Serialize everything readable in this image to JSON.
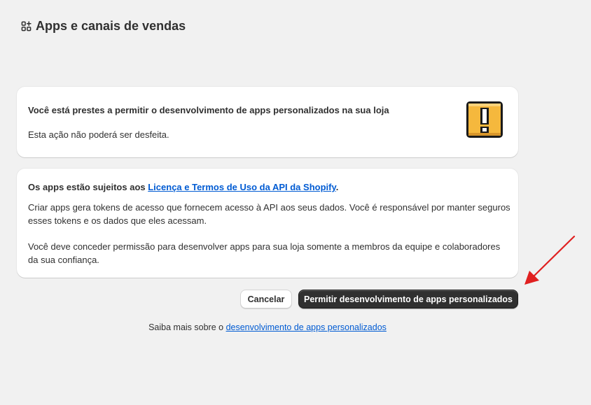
{
  "page": {
    "title": "Apps e canais de vendas",
    "title_icon": "apps-icon"
  },
  "warning_card": {
    "title": "Você está prestes a permitir o desenvolvimento de apps personalizados na sua loja",
    "subtitle": "Esta ação não poderá ser desfeita.",
    "icon": "exclamation-warning-icon",
    "icon_color": "#f5b83d"
  },
  "terms_card": {
    "intro_prefix": "Os apps estão sujeitos aos ",
    "terms_link": "Licença e Termos de Uso da API da Shopify",
    "intro_suffix": ".",
    "paragraph1": "Criar apps gera tokens de acesso que fornecem acesso à API aos seus dados. Você é responsável por manter seguros esses tokens e os dados que eles acessam.",
    "paragraph2": "Você deve conceder permissão para desenvolver apps para sua loja somente a membros da equipe e colaboradores da sua confiança."
  },
  "actions": {
    "cancel_label": "Cancelar",
    "primary_label": "Permitir desenvolvimento de apps personalizados"
  },
  "footer": {
    "prefix": "Saiba mais sobre o ",
    "link": "desenvolvimento de apps personalizados"
  },
  "colors": {
    "background": "#f1f1f1",
    "primary_button": "#303030",
    "link": "#005bd3",
    "annotation_arrow": "#e02020"
  }
}
